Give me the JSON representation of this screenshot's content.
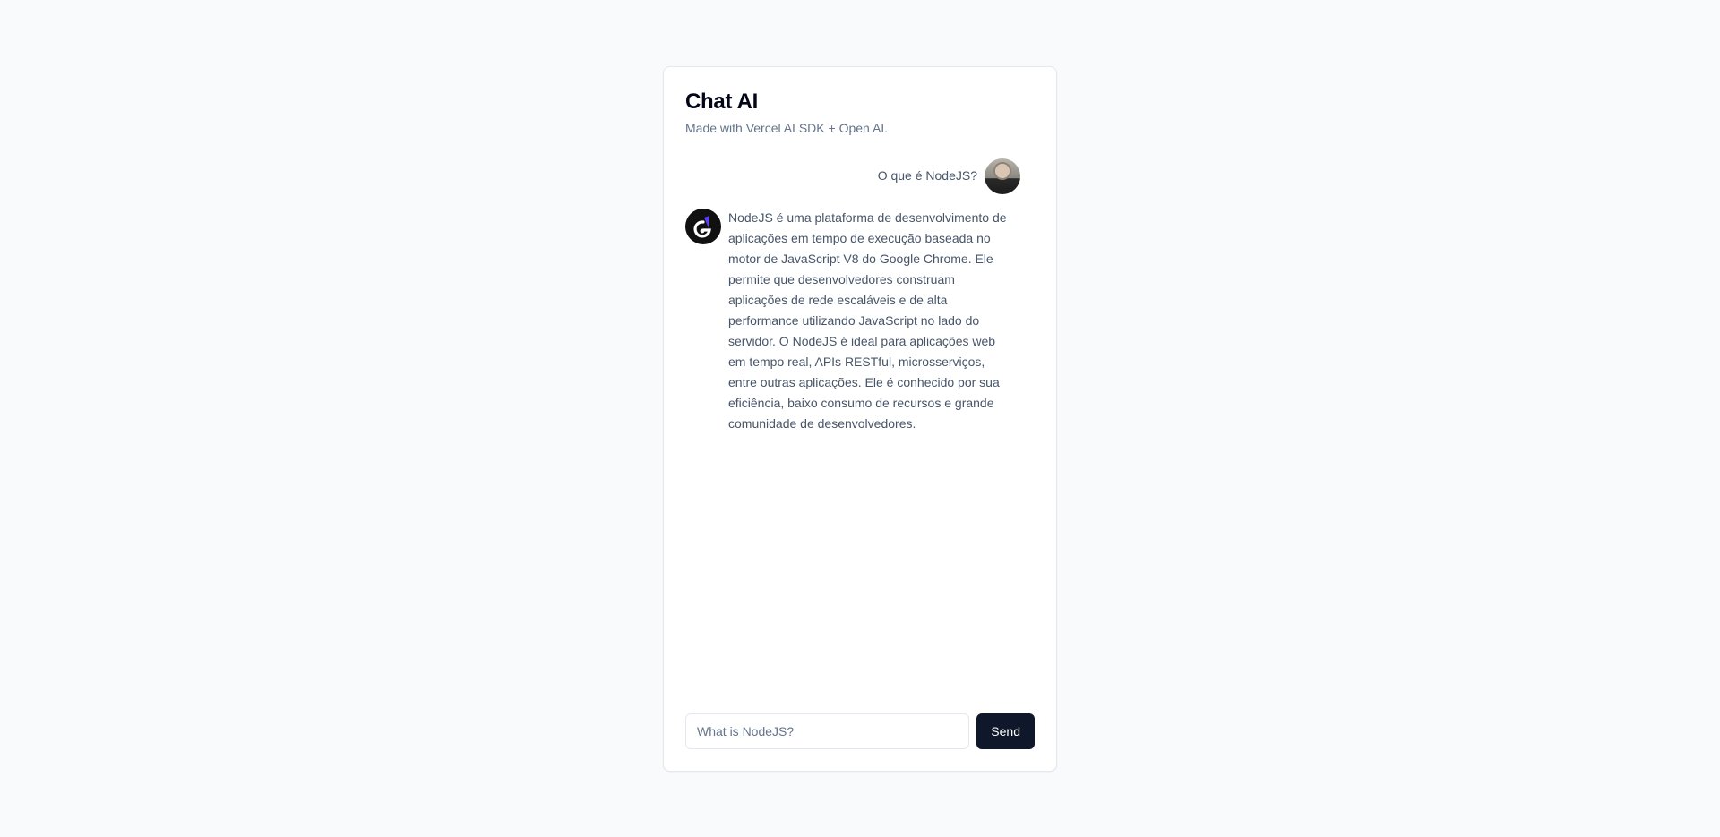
{
  "header": {
    "title": "Chat AI",
    "subtitle": "Made with Vercel AI SDK + Open AI."
  },
  "messages": [
    {
      "role": "user",
      "text": "O que é NodeJS?",
      "avatar": "user-photo-avatar"
    },
    {
      "role": "assistant",
      "text": "NodeJS é uma plataforma de desenvolvimento de aplicações em tempo de execução baseada no motor de JavaScript V8 do Google Chrome. Ele permite que desenvolvedores construam aplicações de rede escaláveis e de alta performance utilizando JavaScript no lado do servidor. O NodeJS é ideal para aplicações web em tempo real, APIs RESTful, microsserviços, entre outras aplicações. Ele é conhecido por sua eficiência, baixo consumo de recursos e grande comunidade de desenvolvedores.",
      "avatar": "ai-logo-avatar"
    }
  ],
  "footer": {
    "input_placeholder": "What is NodeJS?",
    "send_label": "Send"
  },
  "colors": {
    "background": "#f8fafc",
    "card": "#ffffff",
    "primary": "#0f172a",
    "muted_text": "#64748b",
    "body_text": "#475569"
  }
}
